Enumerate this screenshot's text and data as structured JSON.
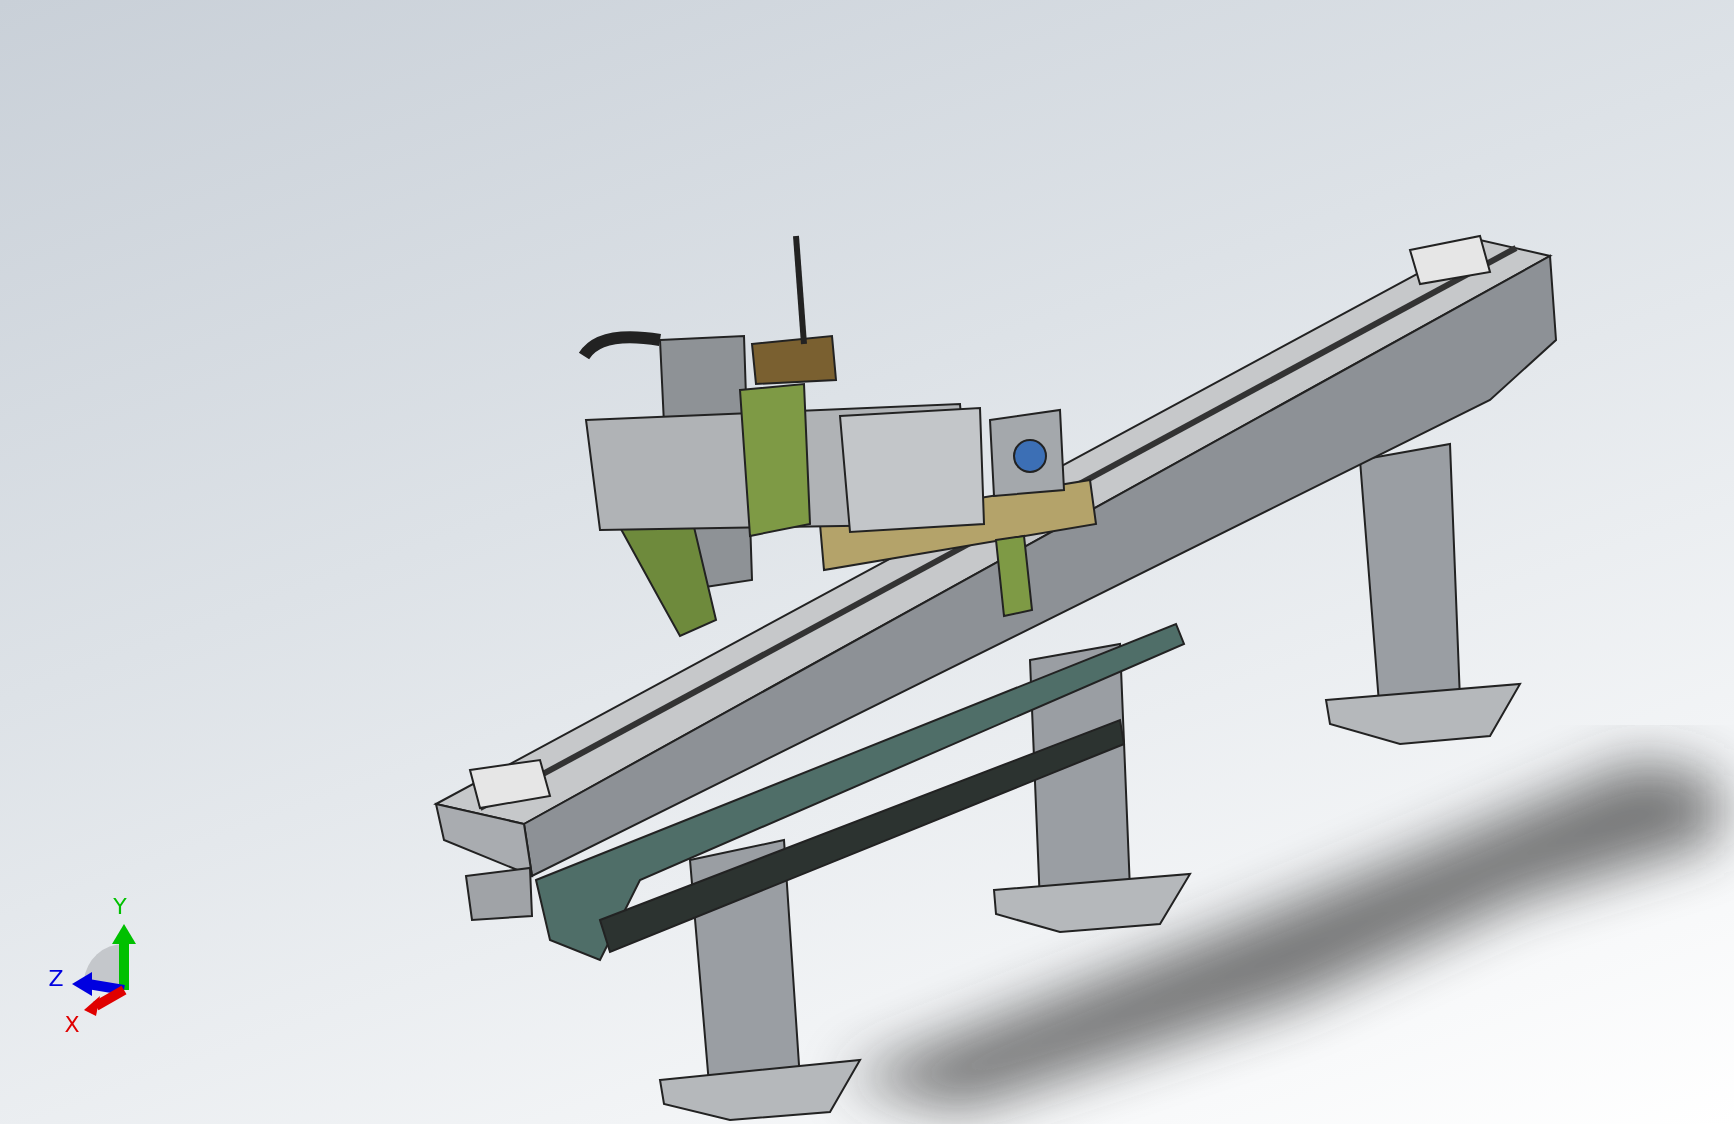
{
  "viewport": {
    "triad": {
      "axes": [
        {
          "label": "Y",
          "color": "#00c000"
        },
        {
          "label": "Z",
          "color": "#0000e0"
        },
        {
          "label": "X",
          "color": "#e00000"
        }
      ]
    }
  }
}
